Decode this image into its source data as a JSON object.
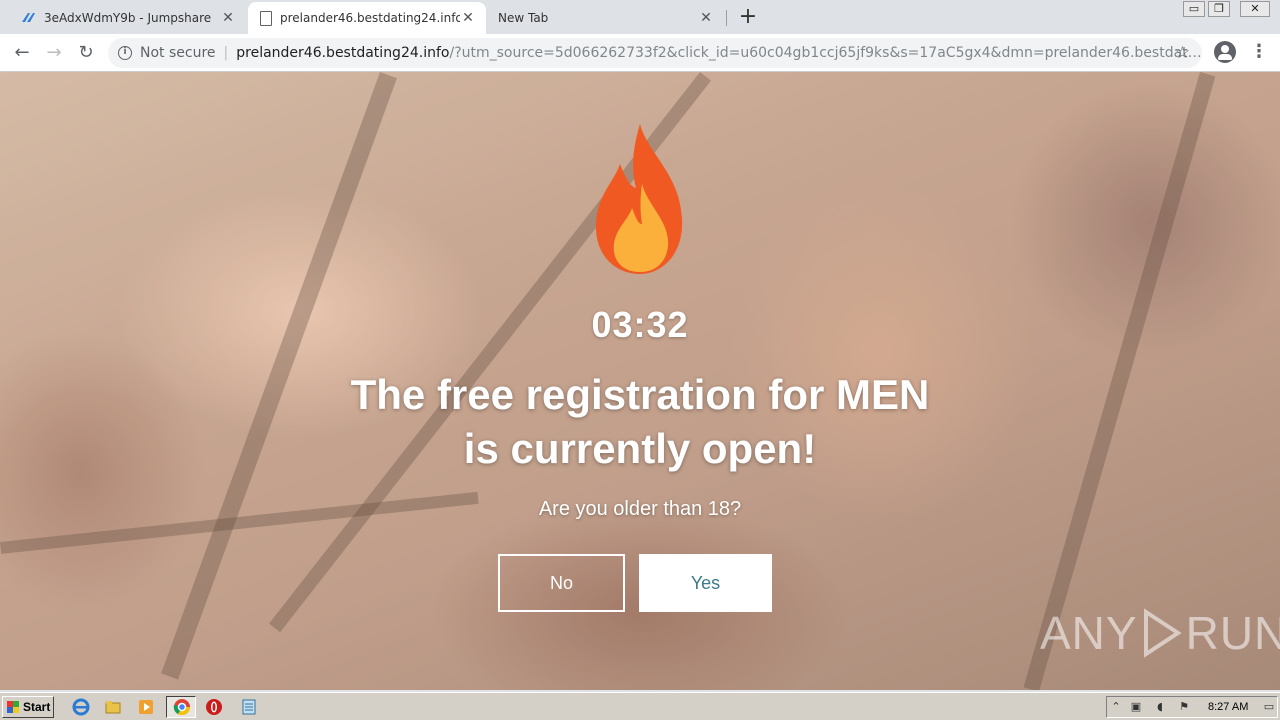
{
  "browser": {
    "tabs": [
      {
        "title": "3eAdxWdmY9b - Jumpshare",
        "favicon": "jumpshare-icon",
        "active": false
      },
      {
        "title": "prelander46.bestdating24.info/?utm",
        "favicon": "page-icon",
        "active": true
      },
      {
        "title": "New Tab",
        "favicon": "",
        "active": false
      }
    ],
    "security_label": "Not secure",
    "url_host": "prelander46.bestdating24.info",
    "url_rest": "/?utm_source=5d066262733f2&click_id=u60c04gb1ccj65jf9ks&s=17aC5gx4&dmn=prelander46.bestdating24.info&r=&..."
  },
  "page": {
    "timer": "03:32",
    "headline": "The free registration for MEN is currently open!",
    "question": "Are you older than 18?",
    "no_label": "No",
    "yes_label": "Yes",
    "watermark_left": "ANY",
    "watermark_right": "RUN",
    "colors": {
      "accent_yes_text": "#3c7a8c",
      "flame_outer": "#f05a22",
      "flame_inner": "#fbb03b"
    }
  },
  "taskbar": {
    "start_label": "Start",
    "clock": "8:27 AM"
  }
}
